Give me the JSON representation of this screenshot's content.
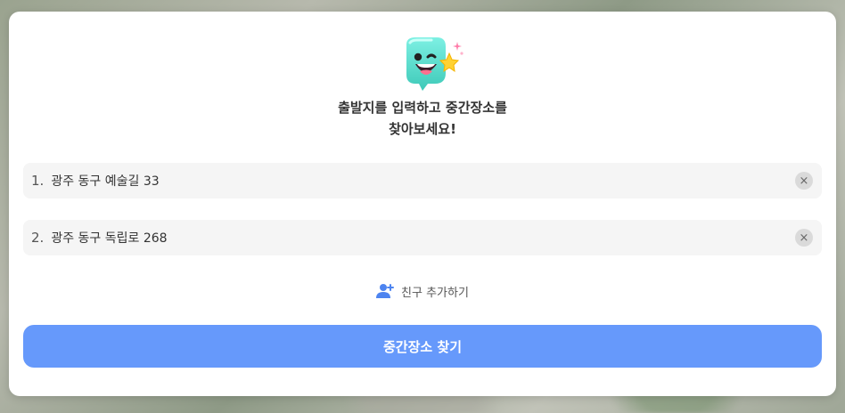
{
  "dialog": {
    "title_line1": "출발지를 입력하고 중간장소를",
    "title_line2": "찾아보세요!",
    "locations": [
      {
        "index": "1.",
        "address": "광주 동구 예술길 33"
      },
      {
        "index": "2.",
        "address": "광주 동구 독립로 268"
      }
    ],
    "add_friend_label": "친구 추가하기",
    "submit_label": "중간장소 찾기",
    "clear_icon": "×"
  },
  "colors": {
    "accent": "#6699fb",
    "mascot": "#5fe0cf",
    "field_bg": "#f5f5f5"
  }
}
